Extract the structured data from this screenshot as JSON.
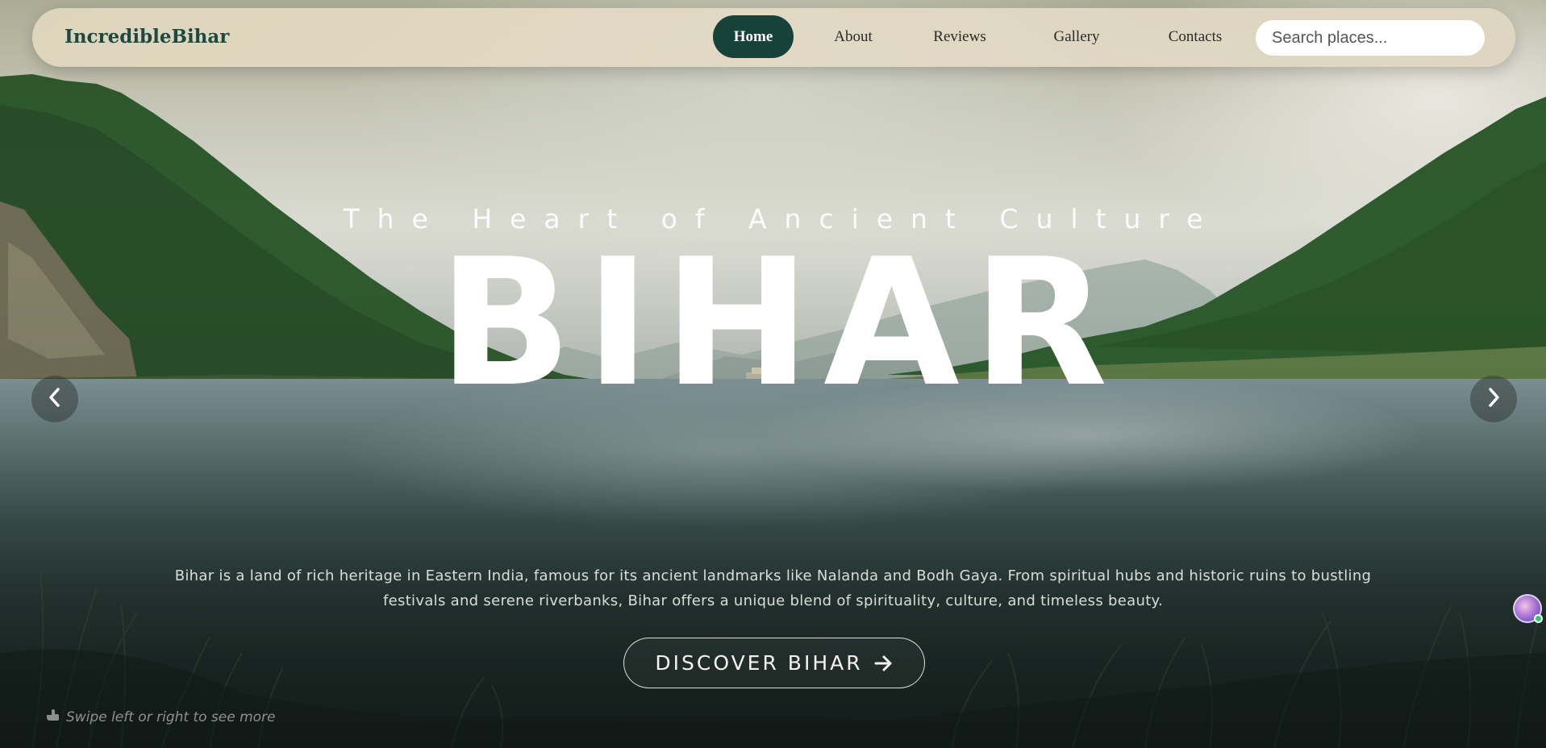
{
  "brand": {
    "name": "IncredibleBihar"
  },
  "nav": {
    "items": [
      {
        "label": "Home",
        "active": true
      },
      {
        "label": "About"
      },
      {
        "label": "Reviews"
      },
      {
        "label": "Gallery"
      },
      {
        "label": "Contacts"
      }
    ],
    "search_placeholder": "Search places..."
  },
  "hero": {
    "tagline": "The Heart of Ancient Culture",
    "title": "BIHAR",
    "description": "Bihar is a land of rich heritage in Eastern India, famous for its ancient landmarks like Nalanda and Bodh Gaya. From spiritual hubs and historic ruins to bustling festivals and serene riverbanks, Bihar offers a unique blend of spirituality, culture, and timeless beauty.",
    "cta_label": "DISCOVER BIHAR",
    "cta_icon": "arrow-right-icon",
    "prev_icon": "chevron-left-icon",
    "next_icon": "chevron-right-icon",
    "swipe_hint": "Swipe left or right to see more",
    "swipe_icon": "pointing-hand-icon"
  },
  "colors": {
    "accent": "#17423a",
    "brand_text": "#1d4a40",
    "navbar_bg": "#e0d6be"
  }
}
